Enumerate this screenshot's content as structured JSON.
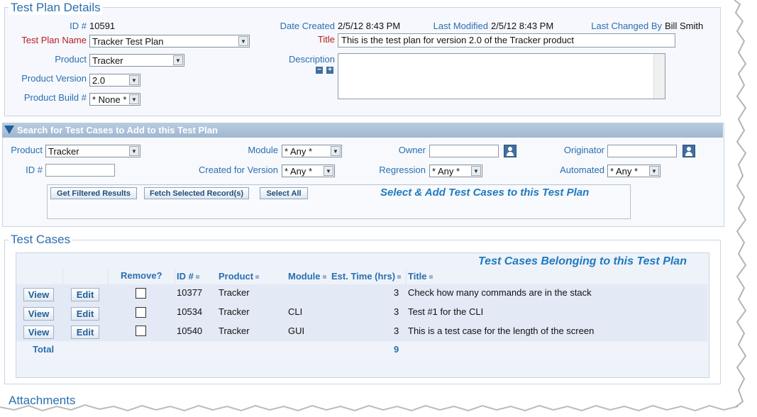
{
  "details": {
    "section_title": "Test Plan Details",
    "id_label": "ID #",
    "id_value": "10591",
    "date_created_label": "Date Created",
    "date_created_value": "2/5/12 8:43 PM",
    "last_modified_label": "Last Modified",
    "last_modified_value": "2/5/12 8:43 PM",
    "last_changed_by_label": "Last Changed By",
    "last_changed_by_value": "Bill Smith",
    "name_label": "Test Plan Name",
    "name_value": "Tracker Test Plan",
    "title_label": "Title",
    "title_value": "This is the test plan for version 2.0 of the Tracker product",
    "product_label": "Product",
    "product_value": "Tracker",
    "description_label": "Description",
    "version_label": "Product Version",
    "version_value": "2.0",
    "build_label": "Product Build #",
    "build_value": "* None *",
    "collapse_icon": "minus-icon",
    "expand_icon": "plus-icon"
  },
  "search": {
    "header": "Search for Test Cases to Add to this Test Plan",
    "product_label": "Product",
    "product_value": "Tracker",
    "module_label": "Module",
    "module_value": "* Any *",
    "owner_label": "Owner",
    "originator_label": "Originator",
    "id_label": "ID #",
    "created_for_label": "Created for Version",
    "created_for_value": "* Any *",
    "regression_label": "Regression",
    "regression_value": "* Any *",
    "automated_label": "Automated",
    "automated_value": "* Any *",
    "btn_filtered": "Get Filtered Results",
    "btn_fetch": "Fetch Selected Record(s)",
    "btn_select_all": "Select All",
    "banner": "Select & Add Test Cases to this Test Plan",
    "user_icon": "user-picker-icon",
    "header_color": "#a9c0d6"
  },
  "cases": {
    "section_title": "Test Cases",
    "banner": "Test Cases Belonging to this Test Plan",
    "columns": {
      "remove": "Remove?",
      "id": "ID #",
      "product": "Product",
      "module": "Module",
      "est_time": "Est. Time (hrs)",
      "title": "Title"
    },
    "view_label": "View",
    "edit_label": "Edit",
    "rows": [
      {
        "id": "10377",
        "product": "Tracker",
        "module": "",
        "est_time": "3",
        "title": "Check how many commands are in the stack"
      },
      {
        "id": "10534",
        "product": "Tracker",
        "module": "CLI",
        "est_time": "3",
        "title": "Test #1 for the CLI"
      },
      {
        "id": "10540",
        "product": "Tracker",
        "module": "GUI",
        "est_time": "3",
        "title": "This is a test case for the length of the screen"
      }
    ],
    "total_label": "Total",
    "total_value": "9"
  },
  "attachments": {
    "section_title": "Attachments"
  }
}
